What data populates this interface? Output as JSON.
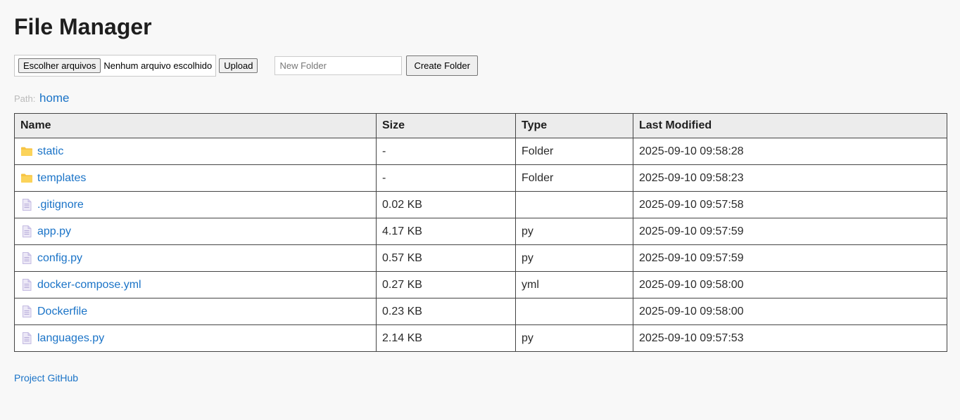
{
  "app": {
    "title": "File Manager"
  },
  "upload": {
    "choose_label": "Escolher arquivos",
    "status": "Nenhum arquivo escolhido",
    "upload_label": "Upload"
  },
  "new_folder": {
    "placeholder": "New Folder",
    "create_label": "Create Folder"
  },
  "path": {
    "label": "Path:",
    "current": "home"
  },
  "table": {
    "headers": {
      "name": "Name",
      "size": "Size",
      "type": "Type",
      "modified": "Last Modified"
    },
    "rows": [
      {
        "icon": "folder-icon",
        "name": "static",
        "size": "-",
        "type": "Folder",
        "modified": "2025-09-10 09:58:28"
      },
      {
        "icon": "folder-icon",
        "name": "templates",
        "size": "-",
        "type": "Folder",
        "modified": "2025-09-10 09:58:23"
      },
      {
        "icon": "file-icon",
        "name": ".gitignore",
        "size": "0.02 KB",
        "type": "",
        "modified": "2025-09-10 09:57:58"
      },
      {
        "icon": "file-icon",
        "name": "app.py",
        "size": "4.17 KB",
        "type": "py",
        "modified": "2025-09-10 09:57:59"
      },
      {
        "icon": "file-icon",
        "name": "config.py",
        "size": "0.57 KB",
        "type": "py",
        "modified": "2025-09-10 09:57:59"
      },
      {
        "icon": "file-icon",
        "name": "docker-compose.yml",
        "size": "0.27 KB",
        "type": "yml",
        "modified": "2025-09-10 09:58:00"
      },
      {
        "icon": "file-icon",
        "name": "Dockerfile",
        "size": "0.23 KB",
        "type": "",
        "modified": "2025-09-10 09:58:00"
      },
      {
        "icon": "file-icon",
        "name": "languages.py",
        "size": "2.14 KB",
        "type": "py",
        "modified": "2025-09-10 09:57:53"
      }
    ]
  },
  "footer": {
    "link": "Project GitHub"
  },
  "colors": {
    "link": "#1a73c7",
    "folder": "#f7c443",
    "file": "#b9aede"
  }
}
